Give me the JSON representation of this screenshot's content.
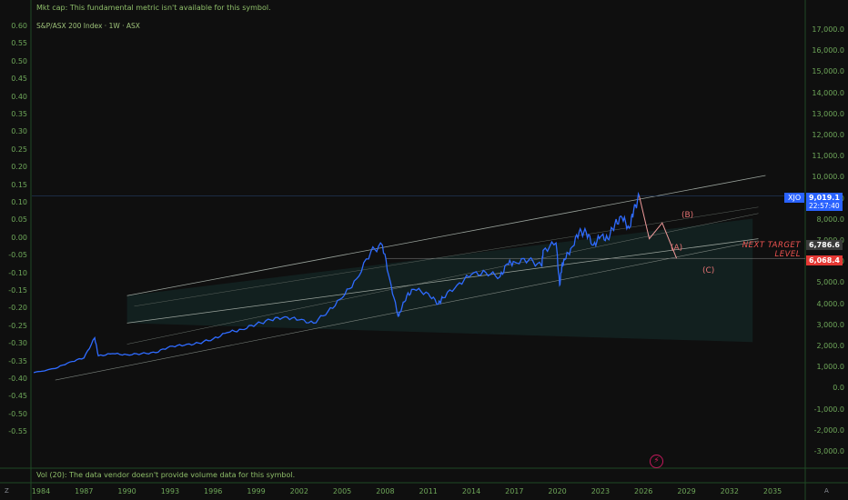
{
  "header": {
    "mkt_cap_note": "Mkt cap: This fundamental metric isn't available for this symbol.",
    "symbol_title": "S&P/ASX 200 Index · 1W · ASX"
  },
  "footer": {
    "volume_note": "Vol (20): The data vendor doesn't provide volume data for this symbol.",
    "left_button": "Z",
    "right_button": "A"
  },
  "axes": {
    "left_ticks": [
      "0.60",
      "0.55",
      "0.50",
      "0.45",
      "0.40",
      "0.35",
      "0.30",
      "0.25",
      "0.20",
      "0.15",
      "0.10",
      "0.05",
      "0.00",
      "-0.05",
      "-0.10",
      "-0.15",
      "-0.20",
      "-0.25",
      "-0.30",
      "-0.35",
      "-0.40",
      "-0.45",
      "-0.50",
      "-0.55"
    ],
    "right_ticks": [
      "17,000.0",
      "16,000.0",
      "15,000.0",
      "14,000.0",
      "13,000.0",
      "12,000.0",
      "11,000.0",
      "10,000.0",
      "9,000.0",
      "8,000.0",
      "7,000.0",
      "6,000.0",
      "5,000.0",
      "4,000.0",
      "3,000.0",
      "2,000.0",
      "1,000.0",
      "0.0",
      "-1,000.0",
      "-2,000.0",
      "-3,000.0"
    ],
    "x_ticks": [
      "1984",
      "1987",
      "1990",
      "1993",
      "1996",
      "1999",
      "2002",
      "2005",
      "2008",
      "2011",
      "2014",
      "2017",
      "2020",
      "2023",
      "2026",
      "2029",
      "2032",
      "2035"
    ]
  },
  "price_tags": {
    "symbol": "XJO",
    "last_price": "9,019.1",
    "countdown": "22:57:40",
    "level_1": "6,786.6",
    "level_2": "6,068.4"
  },
  "annotations": {
    "wave_b": "(B)",
    "wave_a": "(A)",
    "wave_c": "(C)",
    "target_line1": "NEXT TARGET",
    "target_line2": "LEVEL"
  },
  "colors": {
    "price_line": "#2f6bff",
    "channel_fill": "#16302e",
    "projection": "#ef9a9a",
    "level_1_tag": "#3a3a3a",
    "level_2_tag": "#e53935"
  },
  "chart_data": {
    "type": "line",
    "series": [
      {
        "x": [
          1983.5,
          1985,
          1986,
          1987,
          1987.75,
          1988,
          1989,
          1990,
          1991,
          1992,
          1993,
          1994,
          1995,
          1996,
          1997,
          1998,
          1999,
          2000,
          2001,
          2002,
          2003,
          2004,
          2005,
          2006,
          2007,
          2007.8,
          2008.3,
          2008.9,
          2009,
          2009.5,
          2010,
          2011,
          2011.7,
          2012,
          2013,
          2014,
          2015,
          2016,
          2016.5,
          2017,
          2018,
          2018.9,
          2019,
          2019.9,
          2020.15,
          2020.3,
          2020.5,
          2021,
          2021.5,
          2022,
          2022.5,
          2023,
          2023.5,
          2024,
          2024.5,
          2025,
          2025.3,
          2025.7
        ],
        "values": [
          650,
          850,
          1150,
          1350,
          2300,
          1450,
          1550,
          1500,
          1550,
          1600,
          1900,
          1950,
          2050,
          2250,
          2550,
          2700,
          2950,
          3150,
          3300,
          3150,
          3000,
          3550,
          4200,
          5100,
          6400,
          6700,
          5100,
          3300,
          3500,
          4300,
          4600,
          4400,
          3900,
          4200,
          4800,
          5300,
          5400,
          5200,
          5800,
          5900,
          6000,
          5700,
          6450,
          6800,
          4800,
          5700,
          6000,
          6600,
          7300,
          7300,
          6700,
          7100,
          7000,
          7700,
          8000,
          7500,
          8300,
          9019.1
        ]
      }
    ],
    "channel_levels": [
      6786.6,
      6068.4
    ],
    "projection": [
      {
        "year": 2025.7,
        "value": 9019.1
      },
      {
        "year": 2026.4,
        "value": 7000
      },
      {
        "year": 2027.3,
        "value": 7750,
        "label": "(B)"
      },
      {
        "year": 2028.3,
        "value": 6068.4,
        "label": "(C)"
      }
    ]
  }
}
